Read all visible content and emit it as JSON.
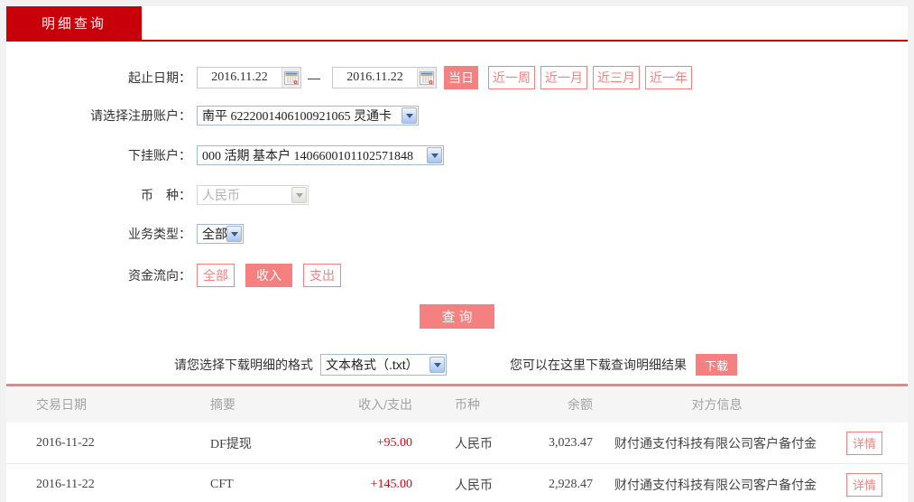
{
  "colors": {
    "brand_red": "#c8000a",
    "accent_salmon": "#f58080",
    "amount_red": "#e60012",
    "page_bg": "#f2f2f2",
    "table_header_bg": "#f5f5f5",
    "table_header_text": "#a3a3a3"
  },
  "tab": {
    "label": "明细查询"
  },
  "form": {
    "date_row": {
      "label": "起止日期：",
      "start_date": "2016.11.22",
      "separator": "—",
      "end_date": "2016.11.22",
      "quick_buttons": [
        {
          "label": "当日",
          "active": true
        },
        {
          "label": "近一周",
          "active": false
        },
        {
          "label": "近一月",
          "active": false
        },
        {
          "label": "近三月",
          "active": false
        },
        {
          "label": "近一年",
          "active": false
        }
      ]
    },
    "register_account": {
      "label": "请选择注册账户：",
      "value": "南平 6222001406100921065 灵通卡"
    },
    "sub_account": {
      "label": "下挂账户：",
      "value": "000 活期 基本户 1406600101102571848"
    },
    "currency": {
      "label": "币　种：",
      "value": "人民币",
      "disabled": true
    },
    "business_type": {
      "label": "业务类型：",
      "value": "全部"
    },
    "fund_flow": {
      "label": "资金流向：",
      "options": [
        {
          "label": "全部",
          "active": false
        },
        {
          "label": "收入",
          "active": true
        },
        {
          "label": "支出",
          "active": false
        }
      ]
    },
    "query_button": "查询"
  },
  "download": {
    "format_label": "请您选择下载明细的格式",
    "format_value": "文本格式（.txt）",
    "hint": "您可以在这里下载查询明细结果",
    "button_label": "下载"
  },
  "table": {
    "headers": [
      "交易日期",
      "摘要",
      "收入/支出",
      "币种",
      "余额",
      "对方信息"
    ],
    "rows": [
      {
        "date": "2016-11-22",
        "summary": "DF提现",
        "amount": "+95.00",
        "currency": "人民币",
        "balance": "3,023.47",
        "counterparty": "财付通支付科技有限公司客户备付金",
        "action": "详情"
      },
      {
        "date": "2016-11-22",
        "summary": "CFT",
        "amount": "+145.00",
        "currency": "人民币",
        "balance": "2,928.47",
        "counterparty": "财付通支付科技有限公司客户备付金",
        "action": "详情"
      }
    ]
  }
}
